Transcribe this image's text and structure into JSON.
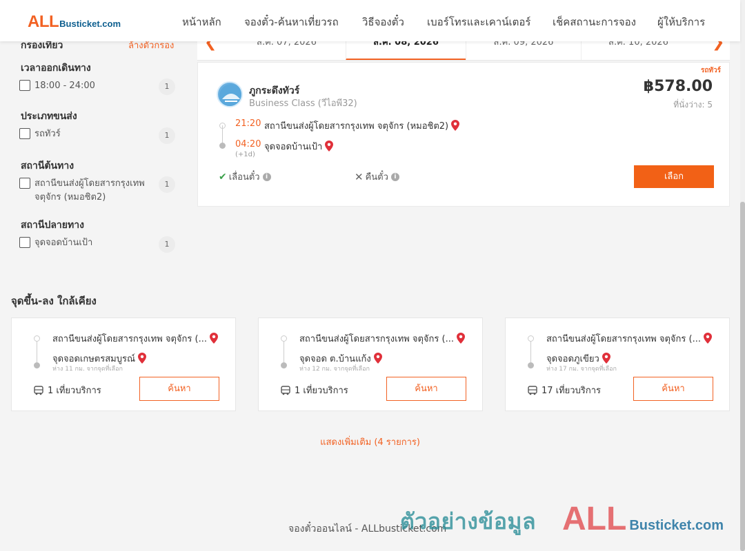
{
  "header": {
    "logo_all": "ALL",
    "logo_rest": "Busticket.com",
    "nav": [
      "หน้าหลัก",
      "จองตั๋ว-ค้นหาเที่ยวรถ",
      "วิธีจองตั๋ว",
      "เบอร์โทรและเคาน์เตอร์",
      "เช็คสถานะการจอง",
      "ผู้ให้บริการ"
    ]
  },
  "sidebar": {
    "title": "กรองเที่ยว",
    "clear": "ล้างตัวกรอง",
    "groups": [
      {
        "title": "เวลาออกเดินทาง",
        "option": "18:00 - 24:00",
        "count": "1"
      },
      {
        "title": "ประเภทขนส่ง",
        "option": "รถทัวร์",
        "count": "1"
      },
      {
        "title": "สถานีต้นทาง",
        "option": "สถานีขนส่งผู้โดยสารกรุงเทพ จตุจักร (หมอชิต2)",
        "count": "1"
      },
      {
        "title": "สถานีปลายทาง",
        "option": "จุดจอดบ้านเป้า",
        "count": "1"
      }
    ]
  },
  "dates": [
    "ส.ค. 07, 2026",
    "ส.ค. 08, 2026",
    "ส.ค. 09, 2026",
    "ส.ค. 10, 2026"
  ],
  "trip": {
    "tag": "รถทัวร์",
    "operator": "ภูกระดึงทัวร์",
    "class": "Business Class (วีไอพี32)",
    "price": "฿578.00",
    "seats": "ที่นั่งว่าง: 5",
    "depart_time": "21:20",
    "depart_station": "สถานีขนส่งผู้โดยสารกรุงเทพ จตุจักร (หมอชิต2)",
    "arrive_time": "04:20",
    "arrive_station": "จุดจอดบ้านเป้า",
    "next_day": "(+1d)",
    "change": "เลื่อนตั๋ว",
    "refund": "คืนตั๋ว",
    "select_label": "เลือก"
  },
  "nearby": {
    "title": "จุดขึ้น-ลง ใกล้เคียง",
    "cards": [
      {
        "from": "สถานีขนส่งผู้โดยสารกรุงเทพ จตุจักร (...",
        "to": "จุดจอดเกษตรสมบูรณ์",
        "distance": "ห่าง 11 กม. จากจุดที่เลือก",
        "trips": "1 เที่ยวบริการ",
        "search": "ค้นหา"
      },
      {
        "from": "สถานีขนส่งผู้โดยสารกรุงเทพ จตุจักร (...",
        "to": "จุดจอด ต.บ้านแก้ง",
        "distance": "ห่าง 12 กม. จากจุดที่เลือก",
        "trips": "1 เที่ยวบริการ",
        "search": "ค้นหา"
      },
      {
        "from": "สถานีขนส่งผู้โดยสารกรุงเทพ จตุจักร (...",
        "to": "จุดจอดภูเขียว",
        "distance": "ห่าง 17 กม. จากจุดที่เลือก",
        "trips": "17 เที่ยวบริการ",
        "search": "ค้นหา"
      }
    ],
    "more": "แสดงเพิ่มเติม (4 รายการ)"
  },
  "footer": "จองตั๋วออนไลน์ - ALLbusticket.com",
  "watermark": {
    "text": "ตัวอย่างข้อมูล",
    "logo_all": "ALL",
    "logo_rest": "Busticket.com"
  },
  "colors": {
    "accent": "#f26122",
    "brand_blue": "#0e5f8f",
    "pin": "#e0303a"
  }
}
